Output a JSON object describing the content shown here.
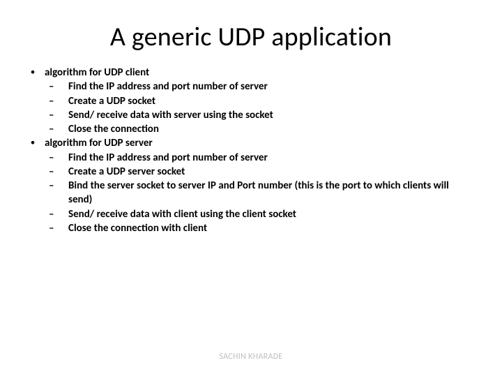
{
  "title": "A generic UDP application",
  "bullets": [
    {
      "text": "algorithm for UDP client",
      "children": [
        "Find the IP address and port number of server",
        "Create a UDP socket",
        "Send/ receive data with server using the socket",
        "Close the connection"
      ]
    },
    {
      "text": "algorithm for UDP server",
      "children": [
        "Find the IP address and port number of server",
        "Create a UDP server socket",
        "Bind the server socket to server IP and Port number (this is the port to which clients will send)",
        "Send/ receive data with client using the client socket",
        "Close the connection with client"
      ]
    }
  ],
  "footer": "SACHIN KHARADE"
}
